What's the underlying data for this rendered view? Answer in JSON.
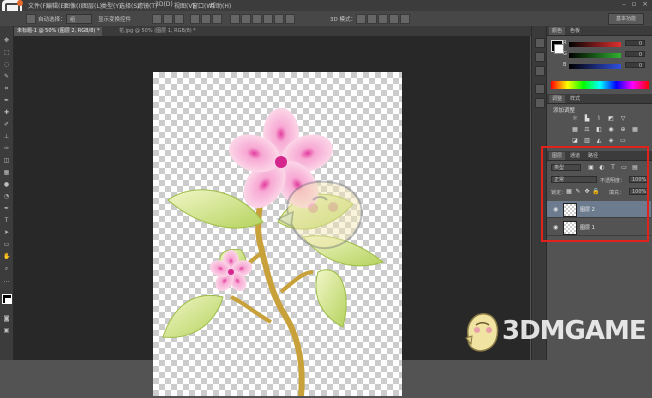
{
  "menu": [
    "文件(F)",
    "编辑(E)",
    "图像(I)",
    "图层(L)",
    "类型(Y)",
    "选择(S)",
    "滤镜(T)",
    "3D(D)",
    "视图(V)",
    "窗口(W)",
    "帮助(H)"
  ],
  "options_bar": {
    "auto_select_label": "自动选择：",
    "auto_select_value": "组",
    "show_transform_label": "显示变换控件",
    "mode_3d_label": "3D 模式：",
    "workspace": "基本功能"
  },
  "tabs": [
    {
      "label": "未标题-1 @ 50% (图层 2, RGB/8) *",
      "active": true
    },
    {
      "label": "花.jpg @ 50% (图层 1, RGB/8) *",
      "active": false
    }
  ],
  "color_panel": {
    "tabs": [
      "颜色",
      "色板"
    ],
    "channels": [
      {
        "letter": "R",
        "value": "0",
        "color": "#e03030"
      },
      {
        "letter": "G",
        "value": "0",
        "color": "#30b030"
      },
      {
        "letter": "B",
        "value": "0",
        "color": "#3050e0"
      }
    ]
  },
  "adjustments_panel": {
    "tabs": [
      "调整",
      "样式"
    ],
    "title": "添加调整"
  },
  "layers_panel": {
    "tabs": [
      "图层",
      "通道",
      "路径"
    ],
    "filter_kind": "类型",
    "blend_mode": "正常",
    "opacity_label": "不透明度：",
    "opacity_value": "100%",
    "lock_label": "锁定：",
    "fill_label": "填充：",
    "fill_value": "100%",
    "layers": [
      {
        "name": "图层 2",
        "visible": true,
        "selected": true
      },
      {
        "name": "图层 1",
        "visible": true,
        "selected": false
      }
    ]
  },
  "watermark": {
    "text": "3DMGAME"
  },
  "colors": {
    "highlight_box": "#e0211c",
    "selected_layer": "#6c7b8e",
    "ps_accent": "#e36a2a"
  }
}
